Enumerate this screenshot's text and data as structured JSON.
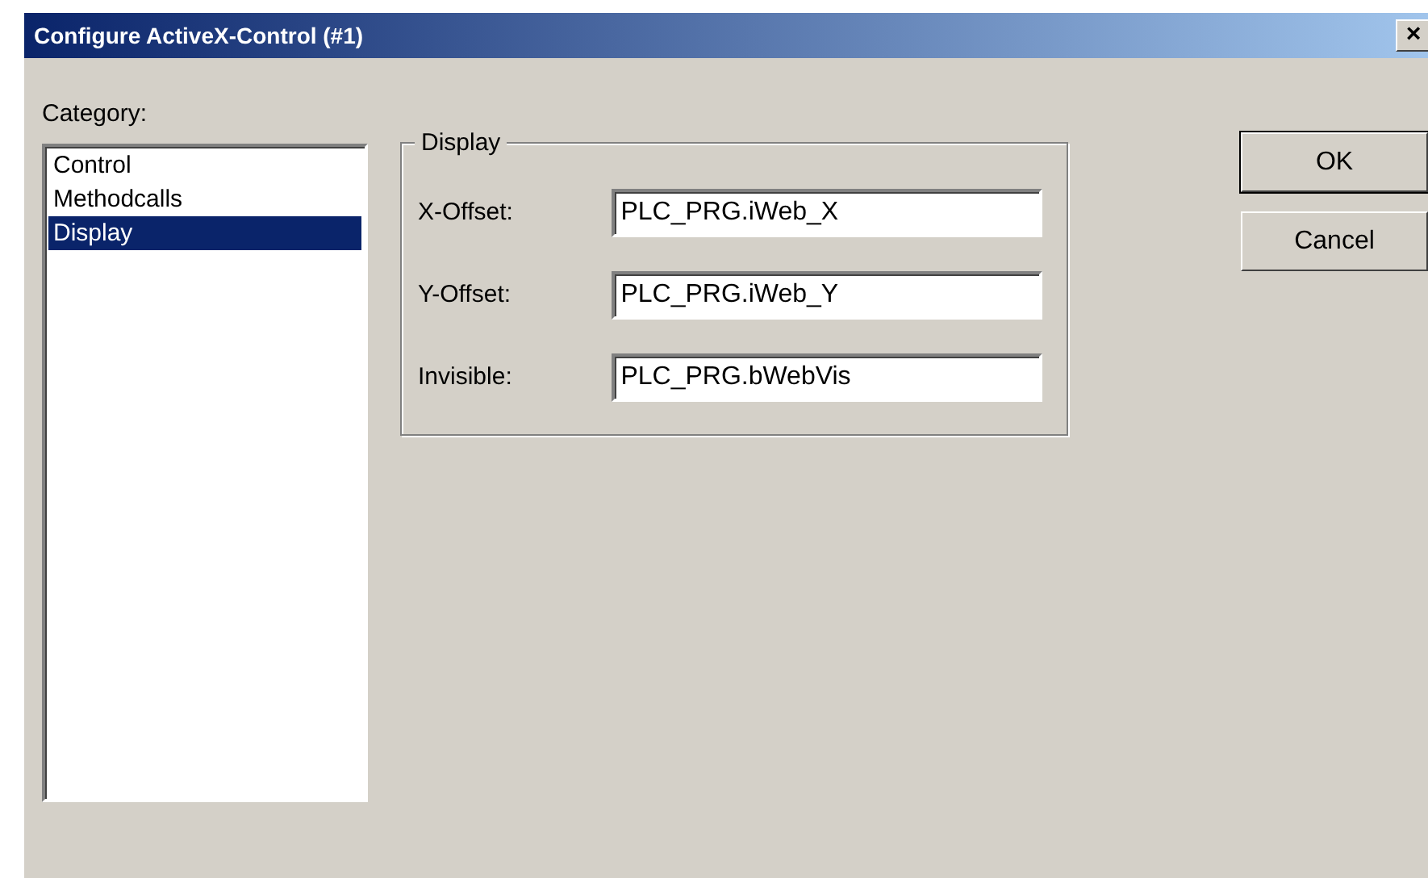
{
  "window": {
    "title": "Configure ActiveX-Control (#1)",
    "close": "×"
  },
  "category": {
    "label": "Category:",
    "items": [
      {
        "label": "Control",
        "selected": false
      },
      {
        "label": "Methodcalls",
        "selected": false
      },
      {
        "label": "Display",
        "selected": true
      }
    ]
  },
  "group": {
    "title": "Display",
    "fields": [
      {
        "label": "X-Offset:",
        "value": "PLC_PRG.iWeb_X"
      },
      {
        "label": "Y-Offset:",
        "value": "PLC_PRG.iWeb_Y"
      },
      {
        "label": "Invisible:",
        "value": "PLC_PRG.bWebVis"
      }
    ]
  },
  "buttons": [
    {
      "label": "OK",
      "default": true
    },
    {
      "label": "Cancel",
      "default": false
    }
  ]
}
